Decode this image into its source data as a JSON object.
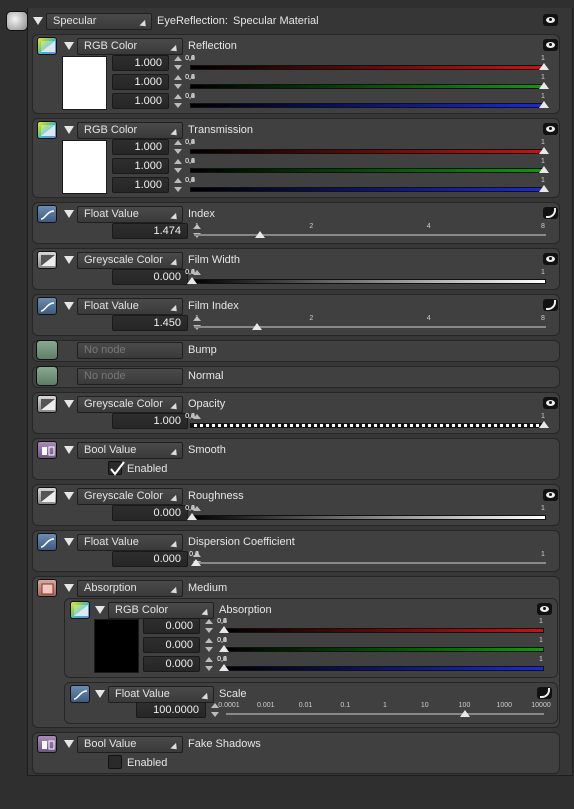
{
  "header": {
    "type_dropdown": "Specular",
    "node_name": "EyeReflection:",
    "material_label": "Specular Material"
  },
  "pins": [
    {
      "type": "RGB Color",
      "name": "Reflection",
      "values": [
        "1.000",
        "1.000",
        "1.000"
      ],
      "swatch": "#ffffff"
    },
    {
      "type": "RGB Color",
      "name": "Transmission",
      "values": [
        "1.000",
        "1.000",
        "1.000"
      ],
      "swatch": "#ffffff"
    },
    {
      "type": "Float Value",
      "name": "Index",
      "value": "1.474",
      "ticks": [
        "1",
        "2",
        "4",
        "8"
      ],
      "level": 1.474
    },
    {
      "type": "Greyscale Color",
      "name": "Film Width",
      "value": "0.000",
      "level": 0.0
    },
    {
      "type": "Float Value",
      "name": "Film Index",
      "value": "1.450",
      "ticks": [
        "1",
        "2",
        "4",
        "8"
      ],
      "level": 1.45
    },
    {
      "type": "No node",
      "name": "Bump"
    },
    {
      "type": "No node",
      "name": "Normal"
    },
    {
      "type": "Greyscale Color",
      "name": "Opacity",
      "value": "1.000",
      "level": 1.0
    },
    {
      "type": "Bool Value",
      "name": "Smooth",
      "checkbox_label": "Enabled",
      "checked": true
    },
    {
      "type": "Greyscale Color",
      "name": "Roughness",
      "value": "0.000",
      "level": 0.0
    },
    {
      "type": "Float Value",
      "name": "Dispersion Coefficient",
      "value": "0.000",
      "level": 0.0
    },
    {
      "type": "Absorption",
      "name": "Medium"
    },
    {
      "type": "Bool Value",
      "name": "Fake Shadows",
      "checkbox_label": "Enabled",
      "checked": false
    }
  ],
  "medium": {
    "absorption": {
      "type": "RGB Color",
      "name": "Absorption",
      "values": [
        "0.000",
        "0.000",
        "0.000"
      ],
      "swatch": "#000000"
    },
    "scale": {
      "type": "Float Value",
      "name": "Scale",
      "value": "100.0000",
      "ticks": [
        "0.0001",
        "0.001",
        "0.01",
        "0.1",
        "1",
        "10",
        "100",
        "1000",
        "10000"
      ],
      "level": 100
    }
  },
  "unit_ticks": [
    "0",
    "0.2",
    "0.4",
    "0.6",
    "0.8",
    "1"
  ],
  "colors": {
    "red": "#d01010",
    "green": "#0f9a0f",
    "blue": "#1a2ad8",
    "panel": "#404040"
  }
}
